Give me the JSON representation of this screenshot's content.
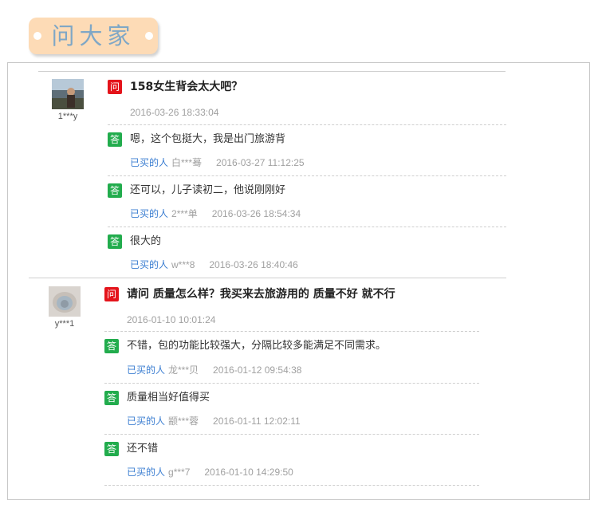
{
  "header": {
    "title": "问大家"
  },
  "colors": {
    "question_badge": "#e4141b",
    "answer_badge": "#22ac4d",
    "buyer_label": "#3a7dd1",
    "header_bg": "#fddbb6",
    "header_text": "#7fa7c6"
  },
  "question_badge": "问",
  "answer_badge": "答",
  "buyer_label": "已买的人",
  "questions": [
    {
      "asker": "1***y",
      "text": "158女生背会太大吧？",
      "time": "2016-03-26 18:33:04",
      "answers": [
        {
          "text": "嗯，这个包挺大，我是出门旅游背",
          "user": "白***蓦",
          "time": "2016-03-27 11:12:25"
        },
        {
          "text": "还可以，儿子读初二，他说刚刚好",
          "user": "2***单",
          "time": "2016-03-26 18:54:34"
        },
        {
          "text": "很大的",
          "user": "w***8",
          "time": "2016-03-26 18:40:46"
        }
      ]
    },
    {
      "asker": "y***1",
      "text": "请问 质量怎么样？我买来去旅游用的 质量不好 就不行",
      "time": "2016-01-10 10:01:24",
      "answers": [
        {
          "text": "不错，包的功能比较强大，分隔比较多能满足不同需求。",
          "user": "龙***贝",
          "time": "2016-01-12 09:54:38"
        },
        {
          "text": "质量相当好值得买",
          "user": "颛***蓉",
          "time": "2016-01-11 12:02:11"
        },
        {
          "text": "还不错",
          "user": "g***7",
          "time": "2016-01-10 14:29:50"
        }
      ]
    }
  ]
}
